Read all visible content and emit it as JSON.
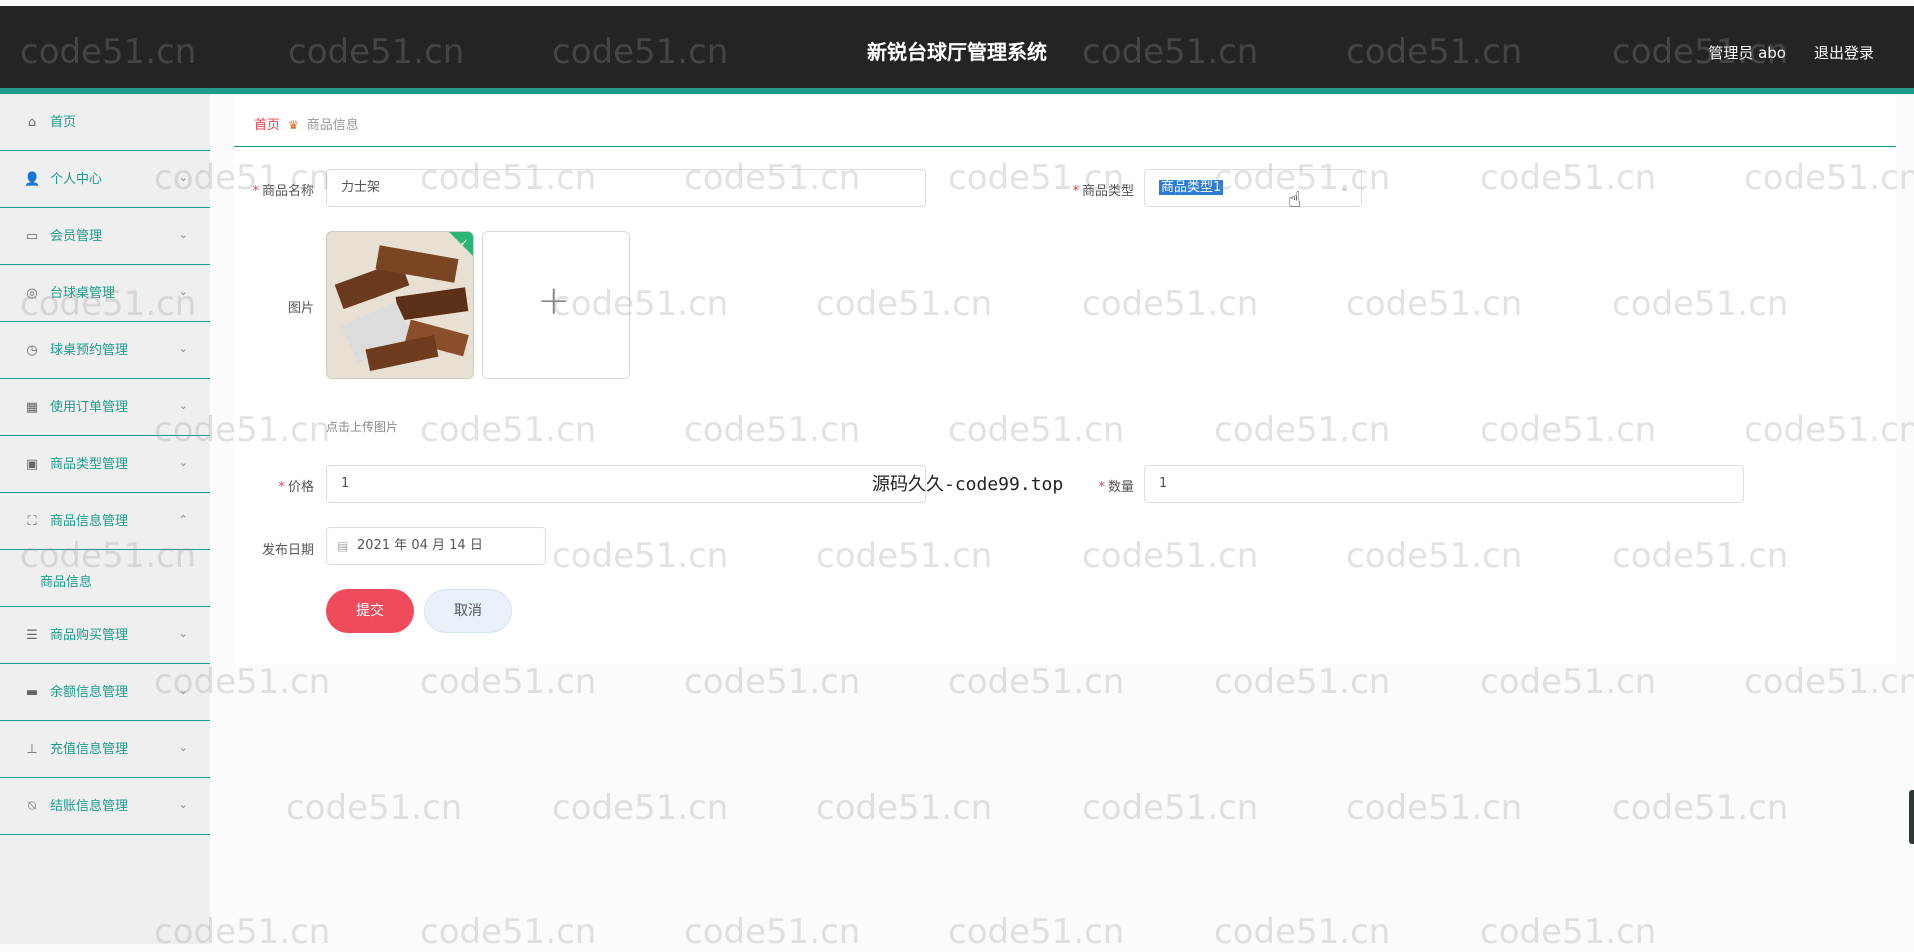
{
  "header": {
    "title": "新锐台球厅管理系统",
    "user_label": "管理员 abo",
    "logout_label": "退出登录"
  },
  "sidebar": {
    "items": [
      {
        "label": "首页",
        "icon": "home-icon"
      },
      {
        "label": "个人中心",
        "icon": "user-icon"
      },
      {
        "label": "会员管理",
        "icon": "chat-icon"
      },
      {
        "label": "台球桌管理",
        "icon": "compass-icon"
      },
      {
        "label": "球桌预约管理",
        "icon": "clock-icon"
      },
      {
        "label": "使用订单管理",
        "icon": "chart-icon"
      },
      {
        "label": "商品类型管理",
        "icon": "bag-icon"
      },
      {
        "label": "商品信息管理",
        "icon": "frame-icon"
      },
      {
        "label": "商品购买管理",
        "icon": "list-icon"
      },
      {
        "label": "余额信息管理",
        "icon": "monitor-icon"
      },
      {
        "label": "充值信息管理",
        "icon": "stamp-icon"
      },
      {
        "label": "结账信息管理",
        "icon": "bell-off-icon"
      }
    ],
    "active_sub": "商品信息"
  },
  "breadcrumb": {
    "home": "首页",
    "current": "商品信息"
  },
  "form": {
    "name_label": "商品名称",
    "name_value": "力士架",
    "type_label": "商品类型",
    "type_value": "商品类型1",
    "image_label": "图片",
    "upload_tip": "点击上传图片",
    "price_label": "价格",
    "price_value": "1",
    "qty_label": "数量",
    "qty_value": "1",
    "date_label": "发布日期",
    "date_value": "2021 年 04 月 14 日",
    "submit_label": "提交",
    "cancel_label": "取消"
  },
  "overlay_text": "源码久久-code99.top",
  "watermark": "code51.cn",
  "colors": {
    "accent": "#1f9b8c",
    "header_bg": "#222426",
    "primary_button": "#ef4b5a",
    "breadcrumb_home": "#e8404d"
  }
}
